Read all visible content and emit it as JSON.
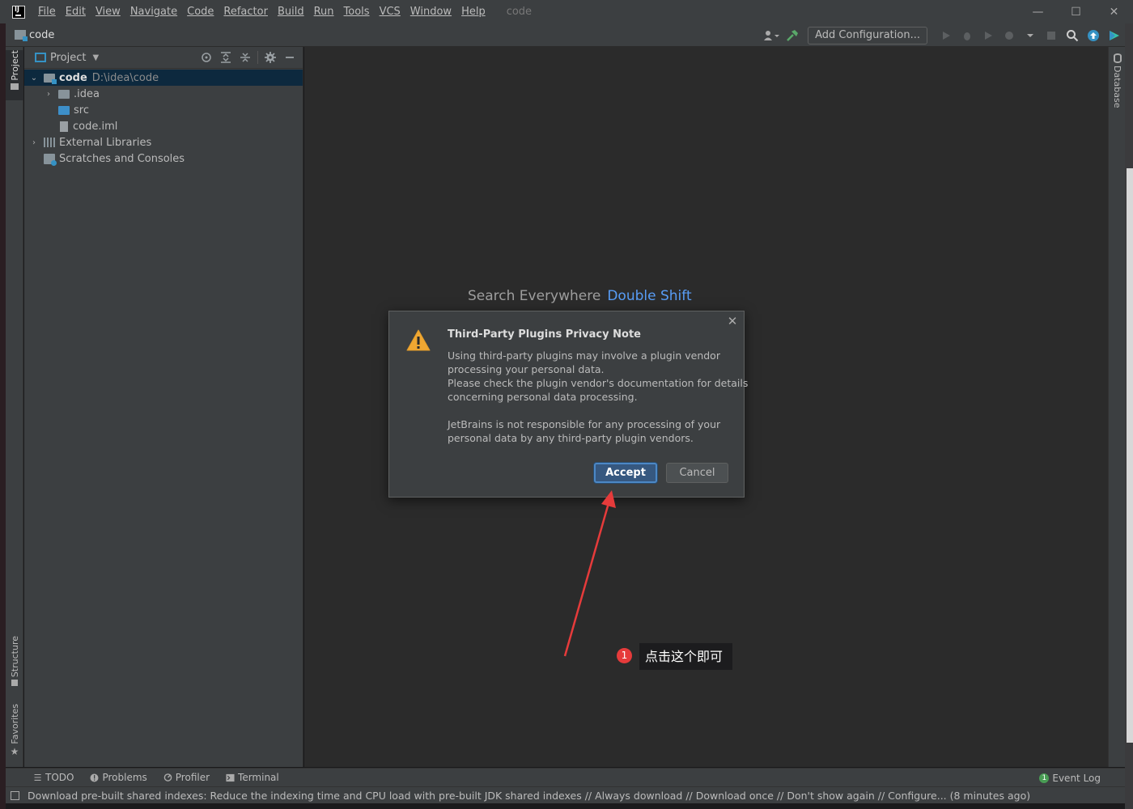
{
  "app": {
    "window_title": "code",
    "menu": [
      {
        "label": "File"
      },
      {
        "label": "Edit"
      },
      {
        "label": "View"
      },
      {
        "label": "Navigate"
      },
      {
        "label": "Code"
      },
      {
        "label": "Refactor"
      },
      {
        "label": "Build"
      },
      {
        "label": "Run"
      },
      {
        "label": "Tools"
      },
      {
        "label": "VCS"
      },
      {
        "label": "Window"
      },
      {
        "label": "Help"
      }
    ]
  },
  "navbar": {
    "breadcrumb": "code",
    "add_configuration": "Add Configuration..."
  },
  "left_tabs": {
    "project": "Project",
    "structure": "Structure",
    "favorites": "Favorites"
  },
  "right_tabs": {
    "database": "Database"
  },
  "project_panel": {
    "title": "Project",
    "tree": [
      {
        "label": "code",
        "hint": "D:\\idea\\code"
      },
      {
        "label": ".idea"
      },
      {
        "label": "src"
      },
      {
        "label": "code.iml"
      },
      {
        "label": "External Libraries"
      },
      {
        "label": "Scratches and Consoles"
      }
    ]
  },
  "editor": {
    "hint_text": "Search Everywhere",
    "hint_shortcut": "Double Shift"
  },
  "dialog": {
    "title": "Third-Party Plugins Privacy Note",
    "lines": [
      "Using third-party plugins may involve a plugin vendor",
      "processing your personal data.",
      "Please check the plugin vendor's documentation for details",
      "concerning personal data processing.",
      "JetBrains is not responsible for any processing of your",
      "personal data by any third-party plugin vendors."
    ],
    "accept": "Accept",
    "cancel": "Cancel"
  },
  "annotation": {
    "badge": "1",
    "text": "点击这个即可",
    "color": "#e63b3b"
  },
  "bottom_bar": {
    "todo": "TODO",
    "problems": "Problems",
    "profiler": "Profiler",
    "terminal": "Terminal",
    "event_log": "Event Log",
    "event_count": "1"
  },
  "status": {
    "text": "Download pre-built shared indexes: Reduce the indexing time and CPU load with pre-built JDK shared indexes // Always download // Download once // Don't show again // Configure... (8 minutes ago)"
  }
}
